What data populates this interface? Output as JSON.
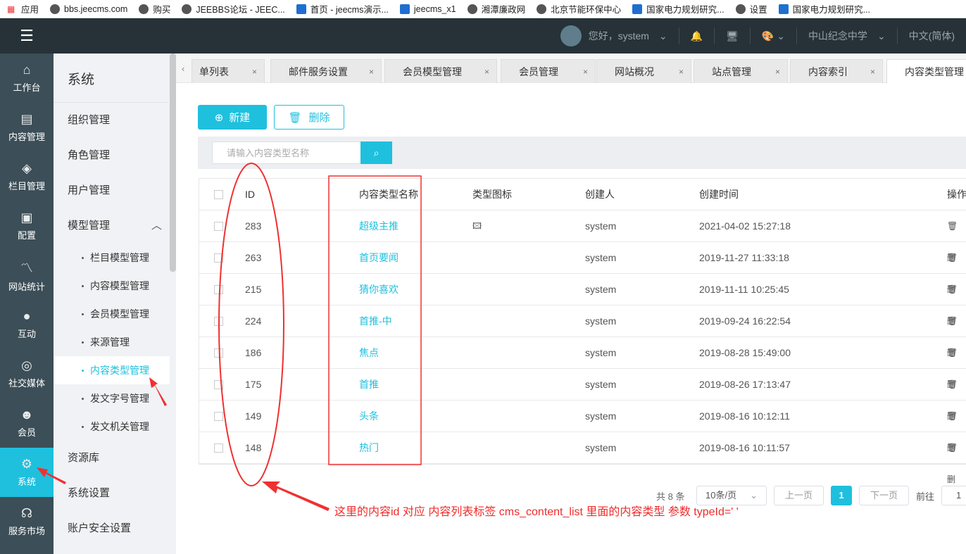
{
  "bookmarks": [
    "应用",
    "bbs.jeecms.com",
    "购买",
    "JEEBBS论坛 - JEEC...",
    "首页 - jeecms演示...",
    "jeecms_x1",
    "湘潭廉政网",
    "北京节能环保中心",
    "国家电力规划研究...",
    "设置",
    "国家电力规划研究..."
  ],
  "header": {
    "greeting": "您好，system",
    "site": "中山纪念中学",
    "language": "中文(简体)"
  },
  "nav": [
    {
      "icon": "home-icon",
      "label": "工作台"
    },
    {
      "icon": "content-icon",
      "label": "内容管理"
    },
    {
      "icon": "layers-icon",
      "label": "栏目管理"
    },
    {
      "icon": "box-icon",
      "label": "配置"
    },
    {
      "icon": "chart-icon",
      "label": "网站统计"
    },
    {
      "icon": "chat-icon",
      "label": "互动"
    },
    {
      "icon": "social-icon",
      "label": "社交媒体"
    },
    {
      "icon": "user-icon",
      "label": "会员"
    },
    {
      "icon": "gear-icon",
      "label": "系统"
    },
    {
      "icon": "service-icon",
      "label": "服务市场"
    }
  ],
  "sidebar": {
    "title": "系统",
    "items": [
      "组织管理",
      "角色管理",
      "用户管理",
      "模型管理"
    ],
    "sub": [
      "栏目模型管理",
      "内容模型管理",
      "会员模型管理",
      "来源管理",
      "内容类型管理",
      "发文字号管理",
      "发文机关管理"
    ],
    "after": [
      "资源库",
      "系统设置",
      "账户安全设置"
    ]
  },
  "tabs": [
    "单列表",
    "邮件服务设置",
    "会员模型管理",
    "会员管理",
    "网站概况",
    "站点管理",
    "内容索引",
    "内容类型管理"
  ],
  "toolbar": {
    "new": "新建",
    "delete": "删除"
  },
  "search": {
    "placeholder": "请输入内容类型名称"
  },
  "table": {
    "headers": [
      "ID",
      "内容类型名称",
      "类型图标",
      "创建人",
      "创建时间",
      "操作"
    ],
    "rows": [
      {
        "id": "283",
        "name": "超级主推",
        "icon": true,
        "creator": "system",
        "time": "2021-04-02 15:27:18"
      },
      {
        "id": "263",
        "name": "首页要闻",
        "creator": "system",
        "time": "2019-11-27 11:33:18"
      },
      {
        "id": "215",
        "name": "猜你喜欢",
        "creator": "system",
        "time": "2019-11-11 10:25:45"
      },
      {
        "id": "224",
        "name": "首推-中",
        "creator": "system",
        "time": "2019-09-24 16:22:54"
      },
      {
        "id": "186",
        "name": "焦点",
        "creator": "system",
        "time": "2019-08-28 15:49:00"
      },
      {
        "id": "175",
        "name": "首推",
        "creator": "system",
        "time": "2019-08-26 17:13:47"
      },
      {
        "id": "149",
        "name": "头条",
        "creator": "system",
        "time": "2019-08-16 10:12:11"
      },
      {
        "id": "148",
        "name": "热门",
        "creator": "system",
        "time": "2019-08-16 10:11:57"
      }
    ]
  },
  "pagination": {
    "total": "共 8 条",
    "page_size": "10条/页",
    "prev": "上一页",
    "current": "1",
    "next": "下一页",
    "goto": "前往",
    "goto_value": "1"
  },
  "annotation": "这里的内容id 对应 内容列表标签 cms_content_list 里面的内容类型 参数 typeId=' '"
}
